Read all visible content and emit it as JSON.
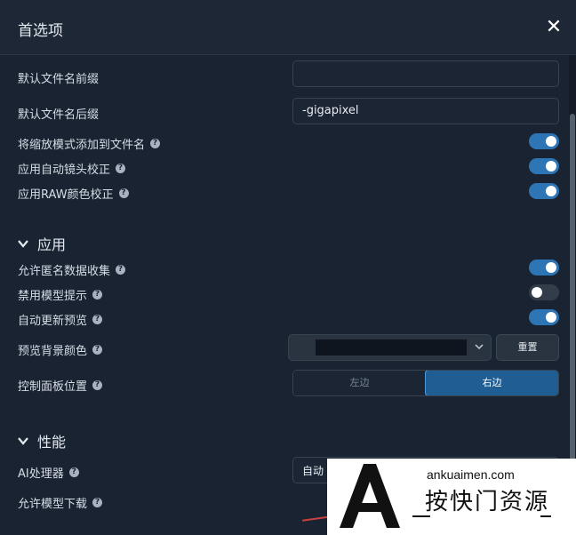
{
  "dialog": {
    "title": "首选项",
    "close_glyph": "✕"
  },
  "rows": {
    "prefix": {
      "label": "默认文件名前缀",
      "value": ""
    },
    "suffix": {
      "label": "默认文件名后缀",
      "value": "-gigapixel"
    },
    "add_scale": {
      "label": "将缩放模式添加到文件名",
      "on": true
    },
    "lens": {
      "label": "应用自动镜头校正",
      "on": true
    },
    "raw": {
      "label": "应用RAW颜色校正",
      "on": true
    }
  },
  "sections": {
    "app": {
      "title": "应用",
      "anon": {
        "label": "允许匿名数据收集",
        "on": true
      },
      "disable_tips": {
        "label": "禁用模型提示",
        "on": false
      },
      "auto_preview": {
        "label": "自动更新预览",
        "on": true
      },
      "bg_color": {
        "label": "预览背景颜色",
        "reset": "重置",
        "swatch": "#0f151e"
      },
      "panel_pos": {
        "label": "控制面板位置",
        "left": "左边",
        "right": "右边",
        "selected": "右边"
      }
    },
    "perf": {
      "title": "性能",
      "ai": {
        "label": "AI处理器",
        "value": "自动"
      },
      "download": {
        "label": "允许模型下载"
      }
    }
  },
  "help_glyph": "?",
  "watermark": {
    "url": "ankuaimen.com",
    "text": "按快门资源"
  },
  "colors": {
    "accent": "#2e75b6",
    "background": "#1a2332",
    "active_segment": "#1f5d93"
  },
  "icons": [
    "close-icon",
    "help-icon",
    "chevron-down-icon",
    "toggle-switch"
  ]
}
